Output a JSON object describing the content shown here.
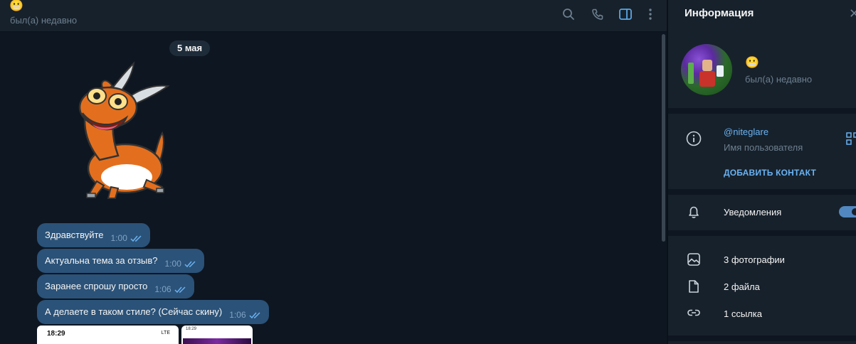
{
  "chat_header": {
    "name": "😬",
    "status": "был(а) недавно"
  },
  "messages": {
    "date": "5 мая",
    "items": [
      {
        "text": "Здравствуйте",
        "time": "1:00"
      },
      {
        "text": "Актуальна тема за отзыв?",
        "time": "1:00"
      },
      {
        "text": "Заранее спрошу просто",
        "time": "1:06"
      },
      {
        "text": "А делаете в таком стиле? (Сейчас скину)",
        "time": "1:06"
      }
    ],
    "screenshot_preview": {
      "time": "18:29",
      "net": "LTE",
      "mini_time": "18:29"
    }
  },
  "info_panel": {
    "title": "Информация",
    "name": "😬",
    "status": "был(а) недавно",
    "username": "@niteglare",
    "username_caption": "Имя пользователя",
    "add_contact": "ДОБАВИТЬ КОНТАКТ",
    "notifications_label": "Уведомления",
    "notifications_on": true,
    "media": {
      "photos": "3 фотографии",
      "files": "2 файла",
      "links": "1 ссылка"
    }
  },
  "colors": {
    "bg": "#0e1621",
    "panel": "#17212b",
    "bubble": "#2b5278",
    "accent": "#6ab2f2",
    "muted": "#6d7f8f"
  },
  "icons": [
    "search-icon",
    "phone-icon",
    "sidebar-toggle-icon",
    "more-vertical-icon",
    "info-icon",
    "qr-code-icon",
    "bell-icon",
    "photo-icon",
    "file-icon",
    "link-icon",
    "read-ticks-icon",
    "close-icon"
  ]
}
